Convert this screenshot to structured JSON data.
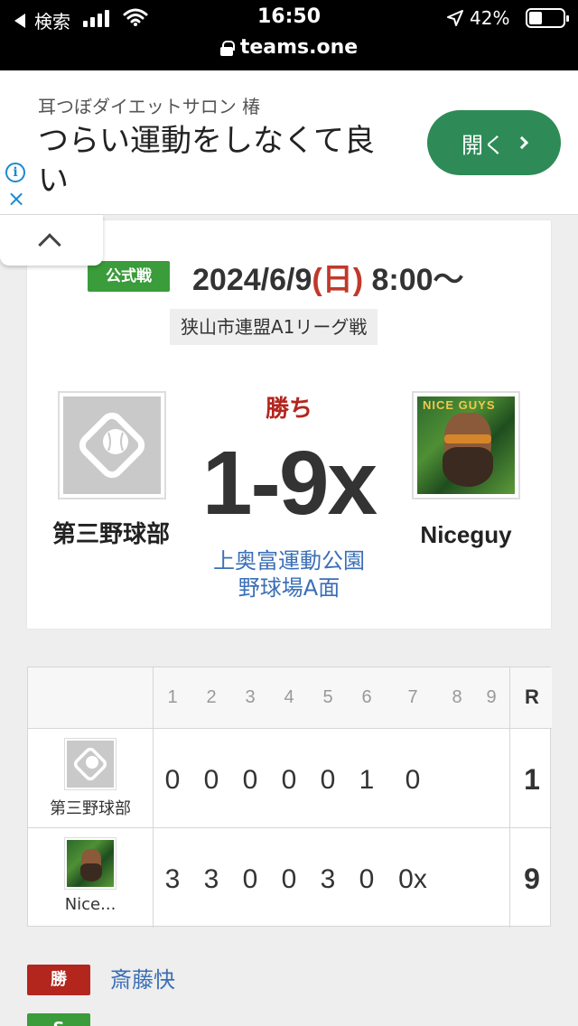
{
  "status_bar": {
    "back_label": "検索",
    "time": "16:50",
    "url": "teams.one",
    "battery": "42%"
  },
  "ad": {
    "sub": "耳つぼダイエットサロン 椿",
    "main": "つらい運動をしなくて良い",
    "button": "開く"
  },
  "game": {
    "type_badge": "公式戦",
    "date_prefix": "2024/6/9",
    "paren_open": "(",
    "day_of_week": "日",
    "paren_close": ")",
    "time": " 8:00～",
    "league": "狭山市連盟A1リーグ戦",
    "result": "勝ち",
    "score": "1-9x",
    "venue_line1": "上奥富運動公園",
    "venue_line2": "野球場A面",
    "home_team": "第三野球部",
    "away_team": "Niceguy",
    "away_logo_text": "NICE GUYS"
  },
  "scoreboard": {
    "innings": [
      "1",
      "2",
      "3",
      "4",
      "5",
      "6",
      "7",
      "8",
      "9"
    ],
    "total_label": "R",
    "rows": [
      {
        "team": "第三野球部",
        "scores": [
          "0",
          "0",
          "0",
          "0",
          "0",
          "1",
          "0",
          "",
          ""
        ],
        "total": "1"
      },
      {
        "team": "Nice...",
        "scores": [
          "3",
          "3",
          "0",
          "0",
          "3",
          "0",
          "0x",
          "",
          ""
        ],
        "total": "9"
      }
    ]
  },
  "pitchers": {
    "win_label": "勝",
    "win_name": "斎藤快",
    "save_label": "S"
  },
  "colors": {
    "accent_green": "#3a9c3a",
    "win_red": "#b3261e",
    "link_blue": "#3b6fb6",
    "ad_button": "#2e8b57"
  }
}
